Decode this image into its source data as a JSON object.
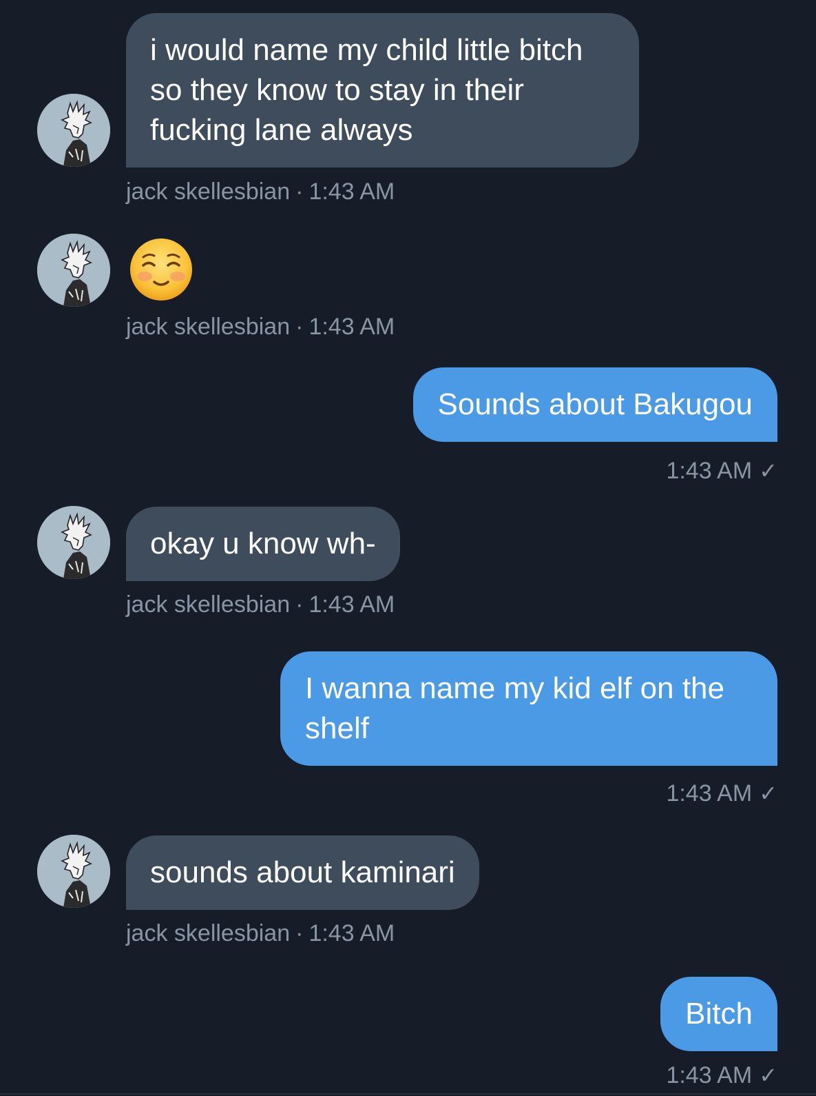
{
  "messages": [
    {
      "text": "i would name my child little bitch\nso they know to stay in their\nfucking lane always",
      "sender": "jack skellesbian",
      "time": "1:43 AM"
    },
    {
      "emoji": "smiling-face-emoji",
      "sender": "jack skellesbian",
      "time": "1:43 AM"
    },
    {
      "text": "Sounds about Bakugou",
      "time": "1:43 AM"
    },
    {
      "text": "okay u know wh-",
      "sender": "jack skellesbian",
      "time": "1:43 AM"
    },
    {
      "text": "I wanna name my kid elf on the\nshelf",
      "time": "1:43 AM"
    },
    {
      "text": "sounds about kaminari",
      "sender": "jack skellesbian",
      "time": "1:43 AM"
    },
    {
      "text": "Bitch",
      "time": "1:43 AM"
    }
  ],
  "separator": "·",
  "read_check": "✓",
  "colors": {
    "background": "#161d29",
    "received_bubble": "#3e4c5c",
    "sent_bubble": "#4a9ae6",
    "meta_text": "#8a95a3"
  },
  "icons": {
    "avatar": "avatar-icon",
    "check": "checkmark-icon"
  }
}
